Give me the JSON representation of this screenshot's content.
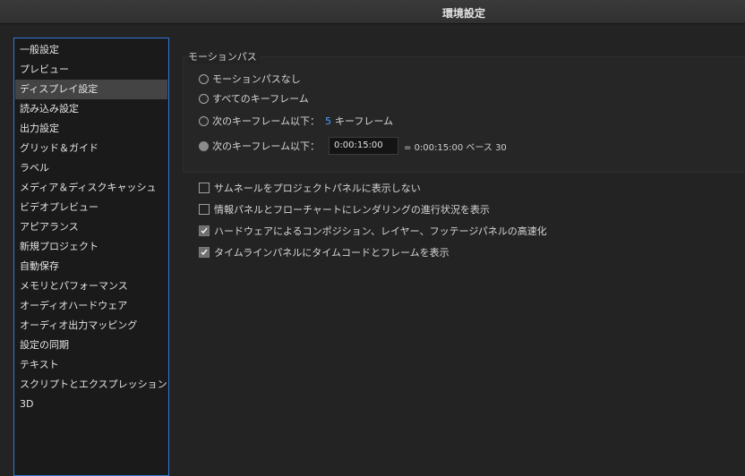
{
  "window": {
    "title": "環境設定"
  },
  "sidebar": {
    "items": [
      {
        "label": "一般設定"
      },
      {
        "label": "プレビュー"
      },
      {
        "label": "ディスプレイ設定",
        "selected": true
      },
      {
        "label": "読み込み設定"
      },
      {
        "label": "出力設定"
      },
      {
        "label": "グリッド＆ガイド"
      },
      {
        "label": "ラベル"
      },
      {
        "label": "メディア＆ディスクキャッシュ"
      },
      {
        "label": "ビデオプレビュー"
      },
      {
        "label": "アピアランス"
      },
      {
        "label": "新規プロジェクト"
      },
      {
        "label": "自動保存"
      },
      {
        "label": "メモリとパフォーマンス"
      },
      {
        "label": "オーディオハードウェア"
      },
      {
        "label": "オーディオ出力マッピング"
      },
      {
        "label": "設定の同期"
      },
      {
        "label": "テキスト"
      },
      {
        "label": "スクリプトとエクスプレッション"
      },
      {
        "label": "3D"
      }
    ]
  },
  "motion_path": {
    "group_label": "モーションパス",
    "option_none": "モーションパスなし",
    "option_all": "すべてのキーフレーム",
    "option_keyframes_prefix": "次のキーフレーム以下：",
    "option_keyframes_count": "5",
    "option_keyframes_suffix": "キーフレーム",
    "option_time_prefix": "次のキーフレーム以下：",
    "option_time_value": "0:00:15:00",
    "option_time_equiv": "= 0:00:15:00  ベース 30",
    "selected_option": "time"
  },
  "checkboxes": [
    {
      "label": "サムネールをプロジェクトパネルに表示しない",
      "checked": false
    },
    {
      "label": "情報パネルとフローチャートにレンダリングの進行状況を表示",
      "checked": false
    },
    {
      "label": "ハードウェアによるコンポジション、レイヤー、フッテージパネルの高速化",
      "checked": true
    },
    {
      "label": "タイムラインパネルにタイムコードとフレームを表示",
      "checked": true
    }
  ],
  "colors": {
    "accent": "#4aa0ff",
    "selection_border": "#3478d6"
  }
}
